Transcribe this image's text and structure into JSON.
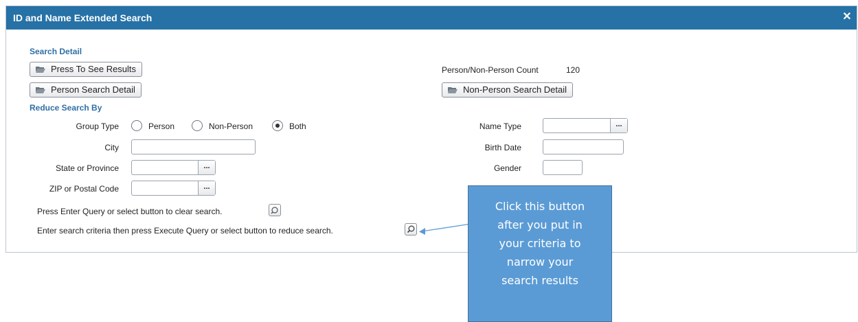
{
  "dialog": {
    "title": "ID and Name Extended Search",
    "close_icon": "close-icon"
  },
  "search_detail": {
    "heading": "Search Detail",
    "press_results_label": "Press To See Results",
    "person_detail_label": "Person Search Detail",
    "nonperson_detail_label": "Non-Person Search Detail",
    "count_label": "Person/Non-Person Count",
    "count_value": "120"
  },
  "reduce": {
    "heading": "Reduce Search By",
    "group_type_label": "Group Type",
    "group_options": [
      "Person",
      "Non-Person",
      "Both"
    ],
    "group_selected": "Both",
    "city_label": "City",
    "state_label": "State or Province",
    "zip_label": "ZIP or Postal Code",
    "name_type_label": "Name Type",
    "birth_date_label": "Birth Date",
    "gender_label": "Gender",
    "lookup_dots": "..."
  },
  "queries": {
    "clear_text": "Press Enter Query or select button to clear search.",
    "execute_text": "Enter search criteria then press Execute Query or select button to reduce search."
  },
  "callout": {
    "text": "Click this button after you put in your criteria to narrow your search results",
    "lines": [
      "Click this button",
      "after you put in",
      "your criteria to",
      "narrow your",
      "search results"
    ]
  }
}
